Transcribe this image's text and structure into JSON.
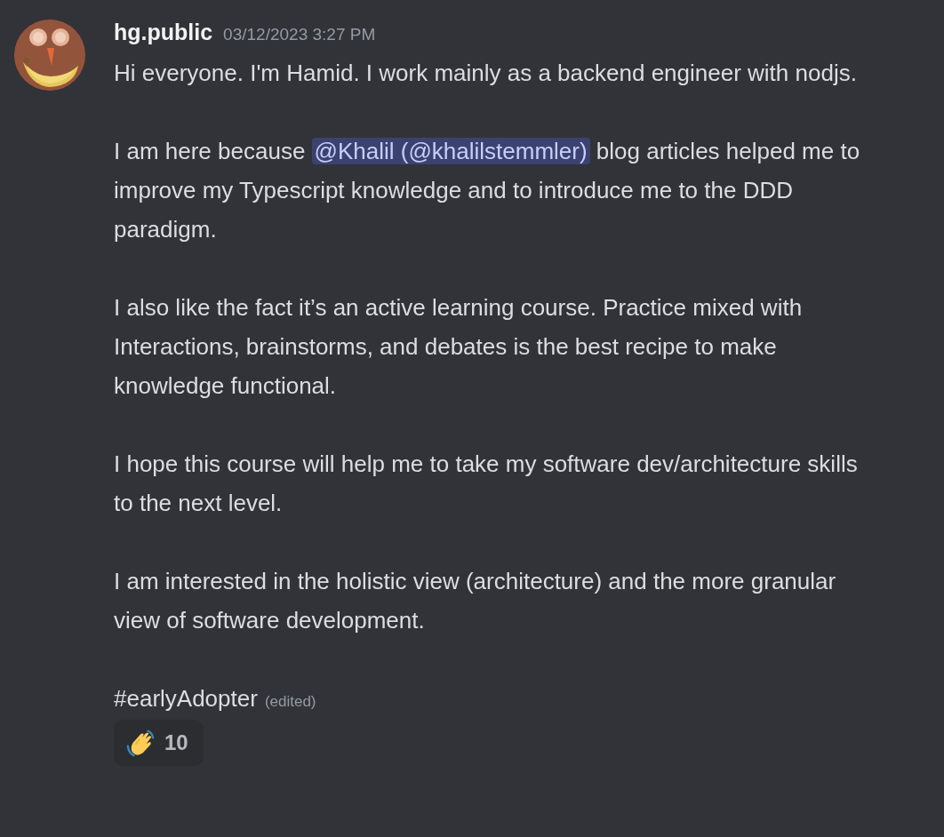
{
  "message": {
    "author": "hg.public",
    "timestamp": "03/12/2023 3:27 PM",
    "paragraphs": [
      {
        "parts": [
          {
            "kind": "text",
            "text": "Hi everyone. I'm Hamid. I work mainly as a backend engineer with nodjs."
          }
        ]
      },
      {
        "parts": [
          {
            "kind": "text",
            "text": "I am here because "
          },
          {
            "kind": "mention",
            "text": "@Khalil (@khalilstemmler)"
          },
          {
            "kind": "text",
            "text": " blog articles helped me to improve my Typescript knowledge and to introduce me to the DDD paradigm."
          }
        ]
      },
      {
        "parts": [
          {
            "kind": "text",
            "text": "I also like the fact it’s an active learning course. Practice mixed with Interactions, brainstorms, and debates is the best recipe to make knowledge functional."
          }
        ]
      },
      {
        "parts": [
          {
            "kind": "text",
            "text": "I hope this course will help me to take my software dev/architecture skills to the next level."
          }
        ]
      },
      {
        "parts": [
          {
            "kind": "text",
            "text": "I am interested in the holistic view (architecture) and the more granular view of software development."
          }
        ]
      },
      {
        "parts": [
          {
            "kind": "text",
            "text": "#earlyAdopter"
          }
        ],
        "edited_label": "(edited)"
      }
    ],
    "reactions": [
      {
        "count": "10",
        "selected": false
      }
    ]
  }
}
